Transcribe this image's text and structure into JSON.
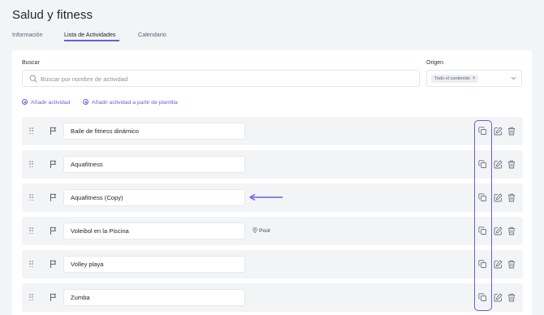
{
  "page": {
    "title": "Salud y fitness"
  },
  "tabs": [
    {
      "label": "Información",
      "active": false
    },
    {
      "label": "Lista de Actividades",
      "active": true
    },
    {
      "label": "Calendario",
      "active": false
    }
  ],
  "filters": {
    "search_label": "Buscar",
    "search_placeholder": "Buscar por nombre de actividad",
    "origin_label": "Origen",
    "origin_chip": "Todo el contenido"
  },
  "actions": {
    "add_activity": "Añadir actividad",
    "add_from_template": "Añadir actividad a partir de plantilla"
  },
  "activities": [
    {
      "name": "Baile de fitness dinámico",
      "tag": ""
    },
    {
      "name": "Aquafitness",
      "tag": ""
    },
    {
      "name": "Aquafitness (Copy)",
      "tag": ""
    },
    {
      "name": "Voleibol en la Piscina",
      "tag": "Pool"
    },
    {
      "name": "Volley playa",
      "tag": ""
    },
    {
      "name": "Zumba",
      "tag": ""
    }
  ],
  "colors": {
    "accent": "#6f59e0",
    "background": "#f3f4f6",
    "card": "#ffffff",
    "row": "#f3f4f6",
    "icon": "#6b7280"
  },
  "icons": {
    "drag": "drag-handle-icon",
    "flag": "flag-icon",
    "copy": "copy-icon",
    "edit": "edit-icon",
    "delete": "trash-icon",
    "search": "search-icon",
    "tag": "location-pin-icon"
  }
}
